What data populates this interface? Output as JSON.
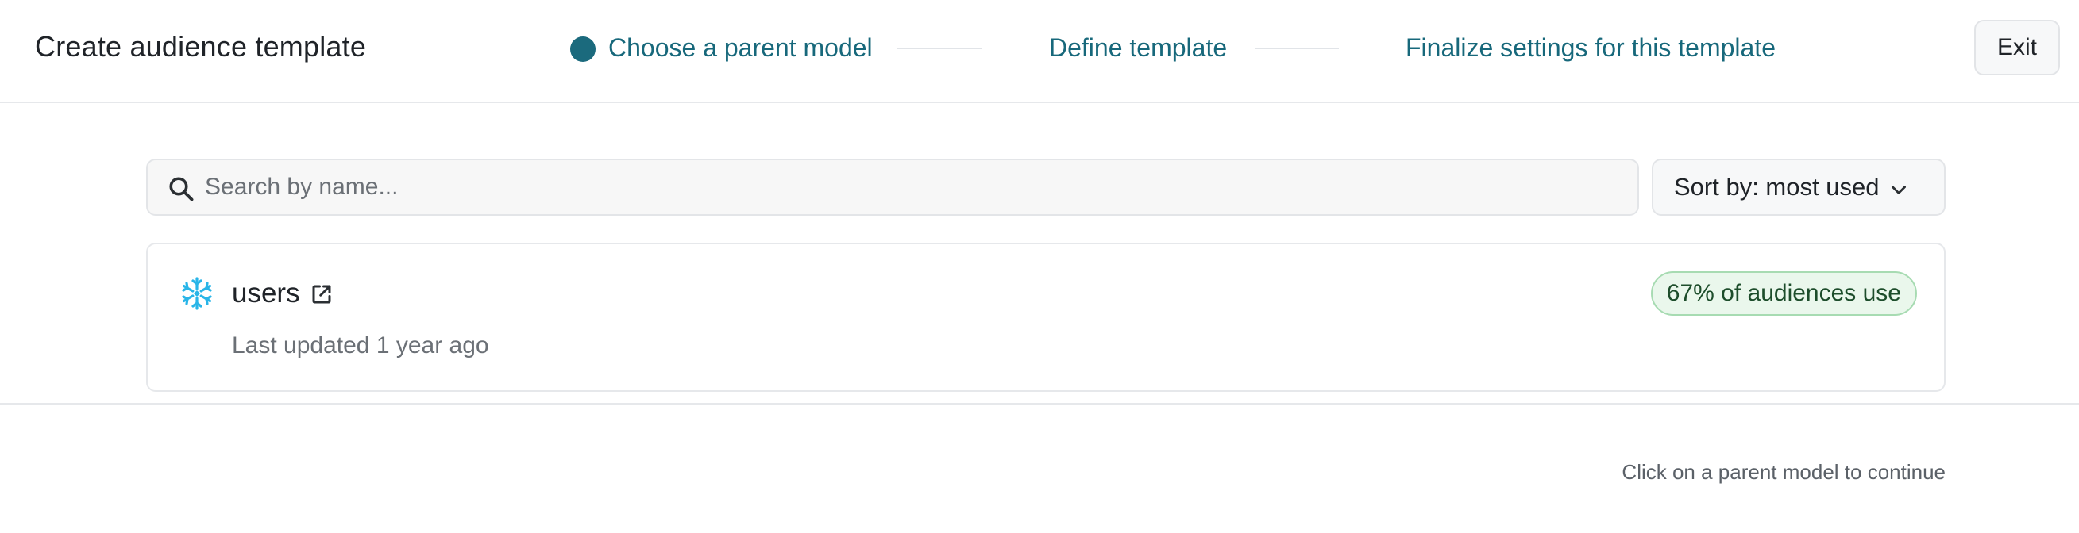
{
  "header": {
    "title": "Create audience template",
    "steps": [
      {
        "label": "Choose a parent model",
        "state": "active"
      },
      {
        "label": "Define template",
        "state": "pending"
      },
      {
        "label": "Finalize settings for this template",
        "state": "pending"
      }
    ],
    "exit_label": "Exit"
  },
  "search": {
    "placeholder": "Search by name...",
    "value": "",
    "icon": "search-icon"
  },
  "sort": {
    "label": "Sort by: most used",
    "icon": "chevron-down-icon"
  },
  "models": [
    {
      "name": "users",
      "source_icon": "snowflake-icon",
      "updated": "Last updated 1 year ago",
      "usage_badge": "67% of audiences use"
    }
  ],
  "footer": {
    "hint": "Click on a parent model to continue"
  },
  "colors": {
    "accent": "#1b6a7d",
    "step_text": "#17687b",
    "badge_bg": "#eaf7ec",
    "badge_border": "#a7dbb2",
    "badge_text": "#1d4d2b",
    "snowflake": "#29b5e8"
  }
}
